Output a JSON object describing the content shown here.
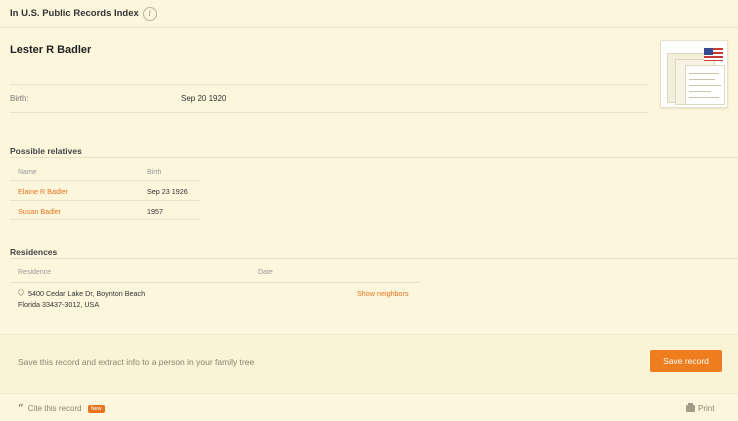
{
  "header": {
    "title": "In U.S. Public Records Index",
    "info_icon": "info-icon"
  },
  "person": {
    "name": "Lester R Badler",
    "facts": [
      {
        "label": "Birth:",
        "value": "Sep 20 1920"
      }
    ]
  },
  "relatives": {
    "title": "Possible relatives",
    "columns": [
      "Name",
      "Birth"
    ],
    "rows": [
      {
        "name": "Elaine R Badler",
        "birth": "Sep 23 1926"
      },
      {
        "name": "Susan Badler",
        "birth": "1957"
      }
    ]
  },
  "residences": {
    "title": "Residences",
    "columns": [
      "Residence",
      "Date"
    ],
    "rows": [
      {
        "line1": "5400 Cedar Lake Dr, Boynton Beach",
        "line2": "Florida 33437-3012, USA",
        "action": "Show neighbors"
      }
    ]
  },
  "cta": {
    "text": "Save this record and extract info to a person in your family tree",
    "button": "Save record"
  },
  "footer": {
    "cite": "Cite this record",
    "badge": "New",
    "print": "Print"
  },
  "colors": {
    "accent": "#ee7d1e",
    "link": "#e8731e",
    "background": "#fcf6dd"
  },
  "icons": [
    "info-icon",
    "us-flag-icon",
    "location-pin-icon",
    "quote-icon",
    "printer-icon"
  ]
}
